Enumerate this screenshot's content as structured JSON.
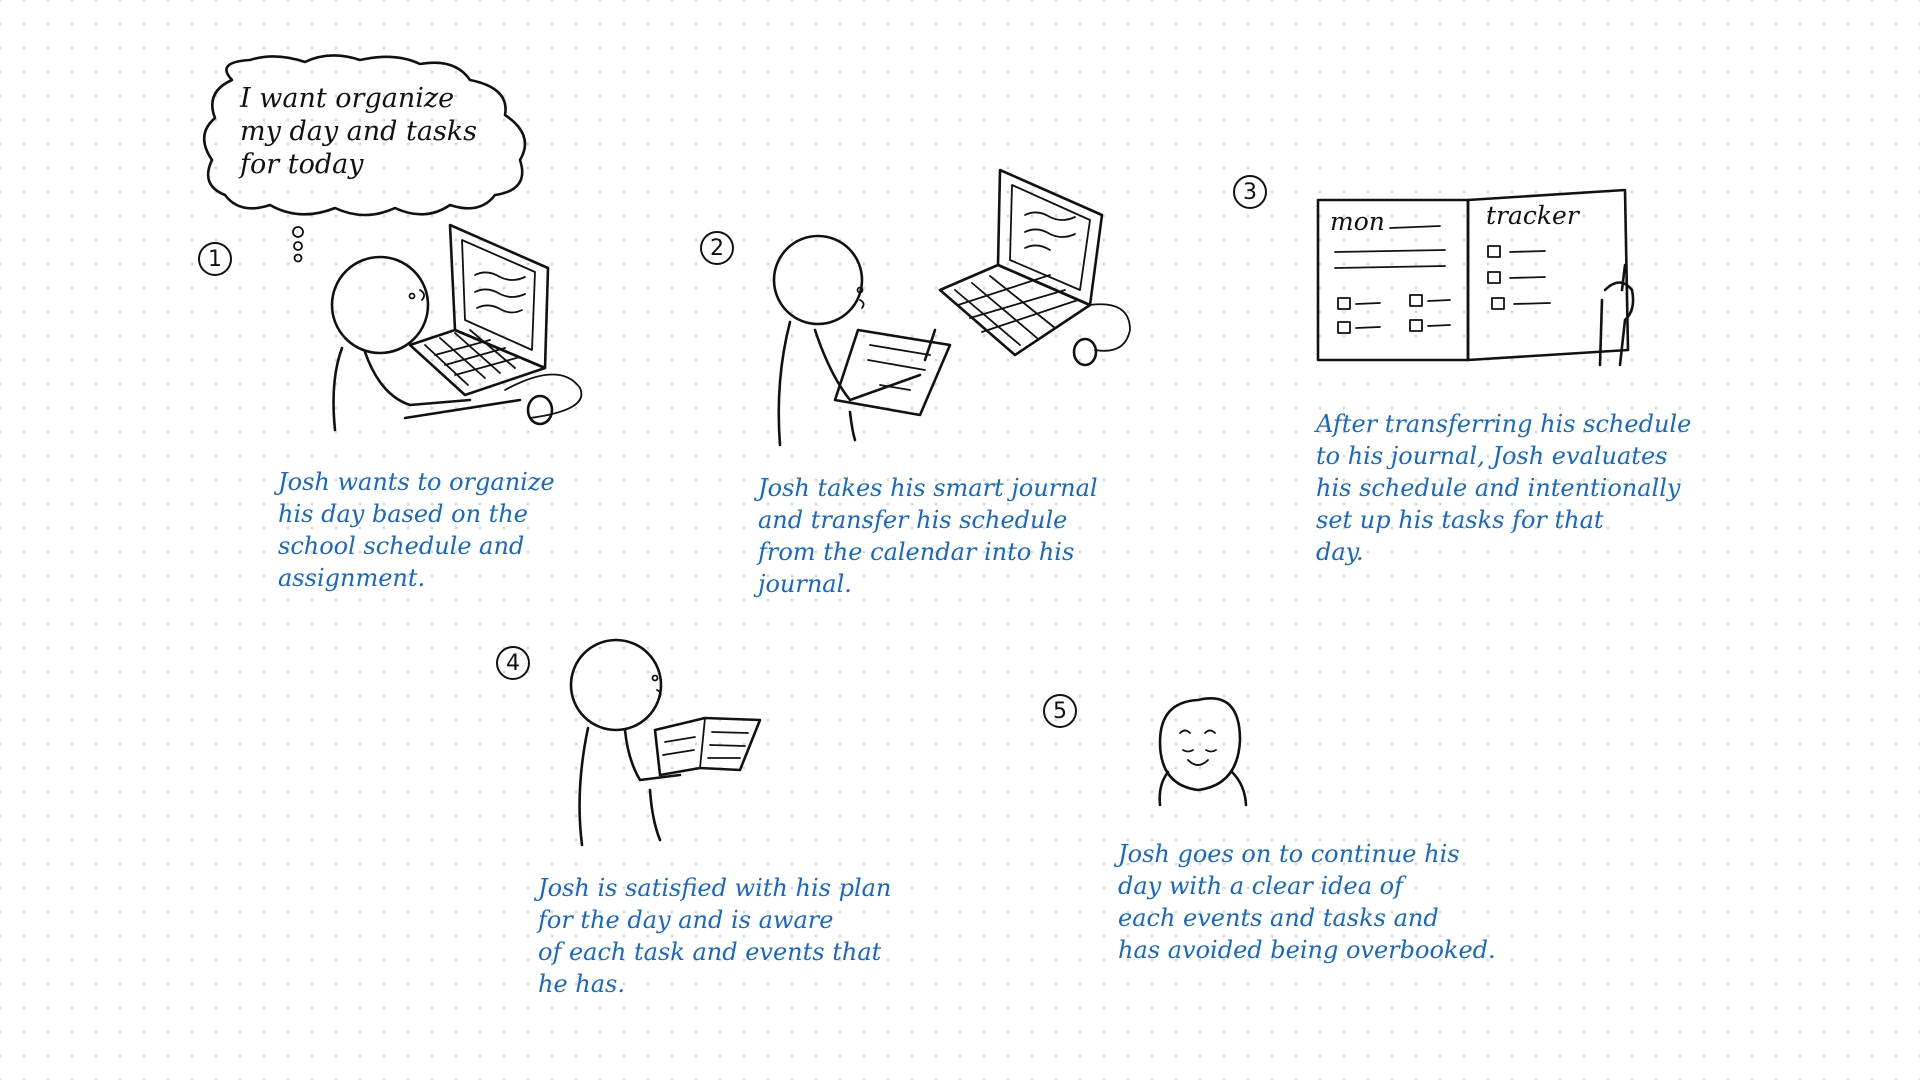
{
  "thought_bubble": {
    "text": "I want organize\nmy day and tasks\nfor today"
  },
  "panels": [
    {
      "number": "1",
      "caption": "Josh wants to organize\nhis day based on the\nschool schedule and\nassignment."
    },
    {
      "number": "2",
      "caption": "Josh takes his smart journal\nand transfer his schedule\nfrom the calendar into his\njournal."
    },
    {
      "number": "3",
      "caption": "After transferring his schedule\nto his journal, Josh evaluates\nhis schedule and intentionally\nset up his tasks for that\nday.",
      "journal_left_label": "mon",
      "journal_right_label": "tracker"
    },
    {
      "number": "4",
      "caption": "Josh is satisfied with his plan\nfor the day and is aware\nof each task and events that\nhe has."
    },
    {
      "number": "5",
      "caption": "Josh goes on to continue his\nday with a clear idea of\neach events and tasks and\nhas avoided being overbooked."
    }
  ],
  "colors": {
    "ink": "#111111",
    "caption_blue": "#1567c8",
    "dot_grid": "#d6d6d6"
  }
}
